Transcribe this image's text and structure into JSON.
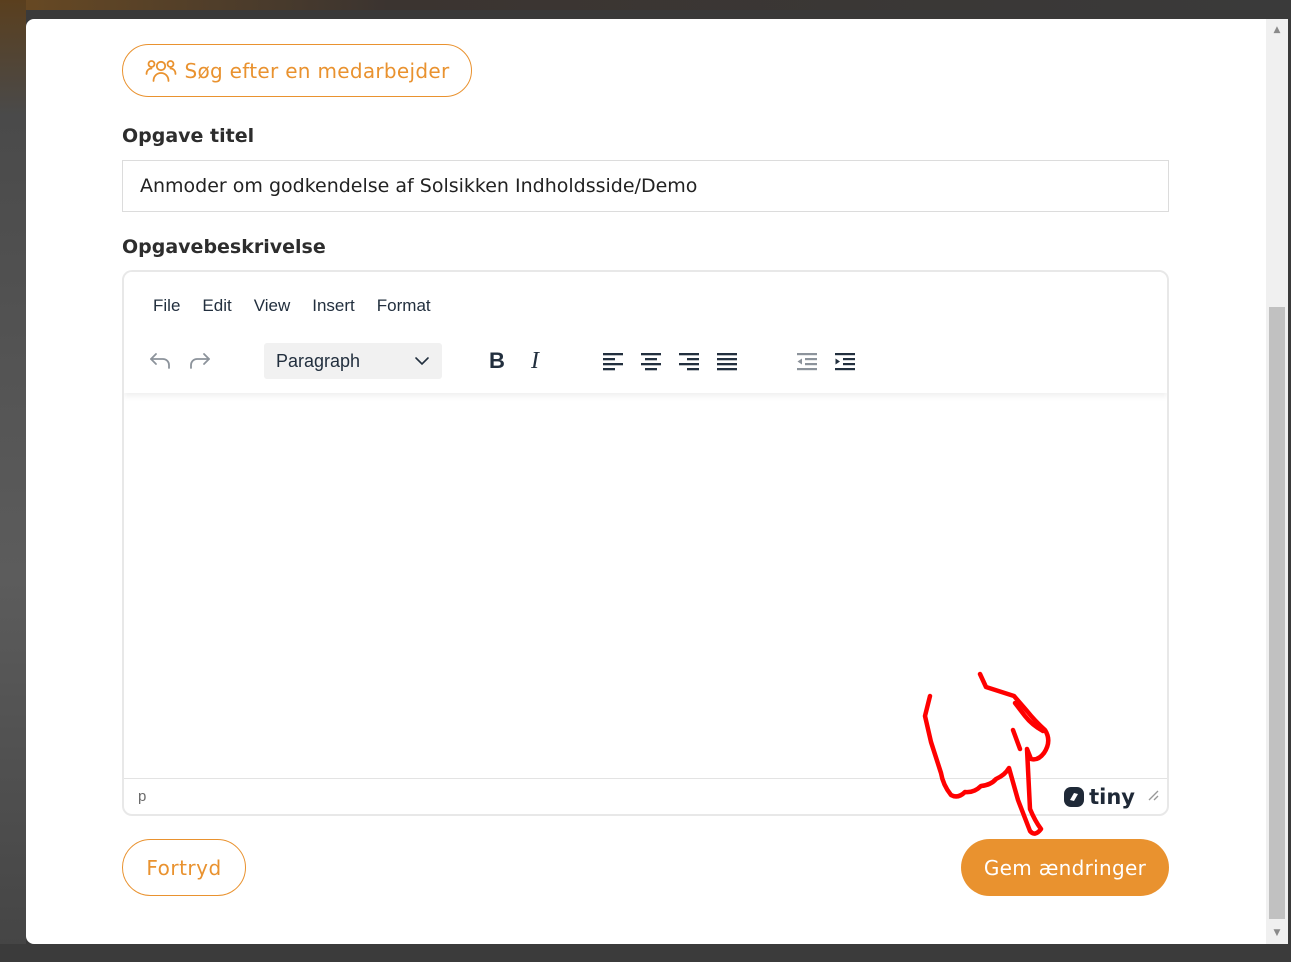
{
  "search_employee": {
    "label": "Søg efter en medarbejder",
    "icon": "users-icon"
  },
  "task_title": {
    "label": "Opgave titel",
    "value": "Anmoder om godkendelse af Solsikken Indholdsside/Demo"
  },
  "task_description": {
    "label": "Opgavebeskrivelse"
  },
  "editor": {
    "menu": [
      "File",
      "Edit",
      "View",
      "Insert",
      "Format"
    ],
    "block_format": "Paragraph",
    "toolbar_icons": [
      "undo-icon",
      "redo-icon",
      "bold-icon",
      "italic-icon",
      "align-left-icon",
      "align-center-icon",
      "align-right-icon",
      "align-justify-icon",
      "outdent-icon",
      "indent-icon"
    ],
    "bold_label": "B",
    "italic_label": "I",
    "status_path": "p",
    "brand": "tiny"
  },
  "actions": {
    "cancel_label": "Fortryd",
    "save_label": "Gem ændringer"
  },
  "colors": {
    "accent": "#e9922f",
    "annotation": "#ff0000"
  }
}
